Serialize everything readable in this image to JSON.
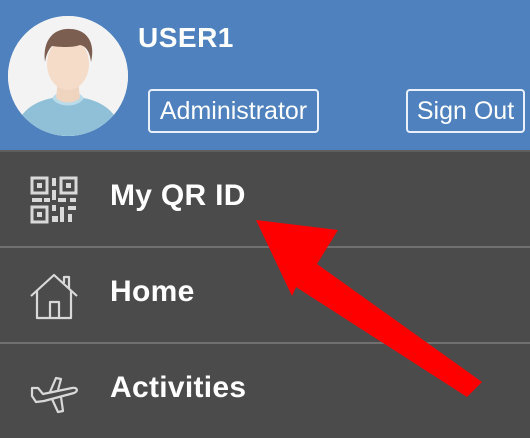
{
  "header": {
    "username": "USER1",
    "role_button": "Administrator",
    "signout_button": "Sign Out",
    "background": "#4e81bd"
  },
  "menu": {
    "items": [
      {
        "label": "My QR ID",
        "icon": "qr-code-icon"
      },
      {
        "label": "Home",
        "icon": "house-icon"
      },
      {
        "label": "Activities",
        "icon": "airplane-icon"
      }
    ],
    "background": "#4b4b4b"
  },
  "annotation": {
    "type": "arrow",
    "color": "#ff0000",
    "points_to": "My QR ID"
  }
}
